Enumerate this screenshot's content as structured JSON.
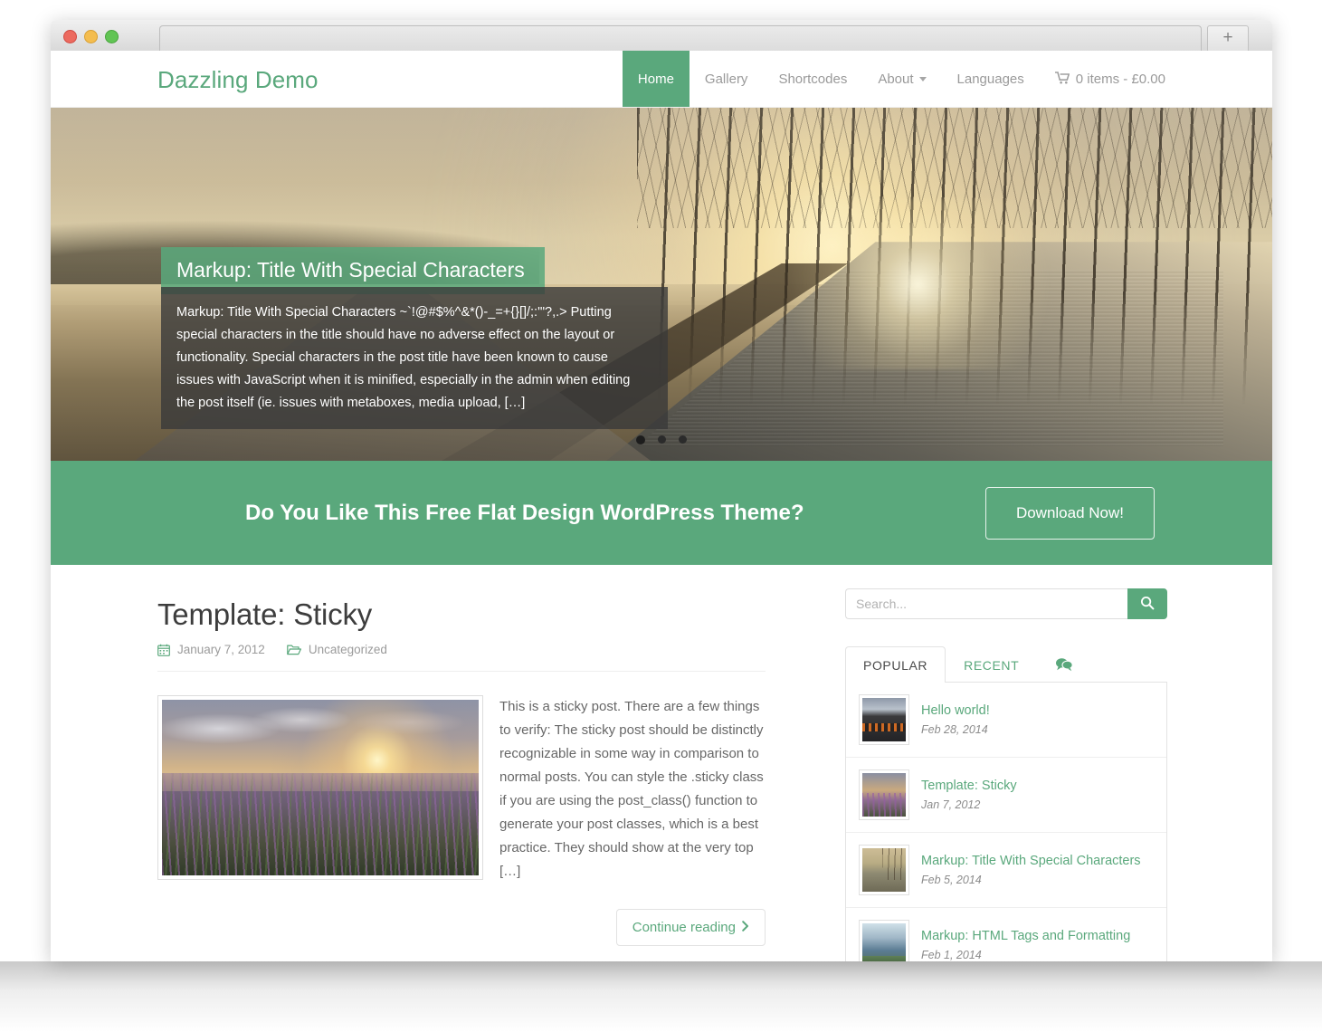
{
  "browser": {
    "traffic_lights": [
      "close",
      "minimize",
      "zoom"
    ],
    "new_tab_label": "+"
  },
  "header": {
    "brand": "Dazzling Demo",
    "nav": [
      {
        "label": "Home",
        "active": true,
        "caret": false
      },
      {
        "label": "Gallery",
        "active": false,
        "caret": false
      },
      {
        "label": "Shortcodes",
        "active": false,
        "caret": false
      },
      {
        "label": "About",
        "active": false,
        "caret": true
      },
      {
        "label": "Languages",
        "active": false,
        "caret": false
      }
    ],
    "cart_label": "0 items - £0.00"
  },
  "slider": {
    "title": "Markup: Title With Special Characters",
    "body": "Markup: Title With Special Characters ~`!@#$%^&*()-_=+{}[]/;:'\"?,.> Putting special characters in the title should have no adverse effect on the layout or functionality. Special characters in the post title have been known to cause issues with JavaScript when it is minified, especially in the admin when editing the post itself (ie. issues with metaboxes, media upload, […]",
    "dots": 3,
    "active_dot": 1
  },
  "cta": {
    "text": "Do You Like This Free Flat Design WordPress Theme?",
    "button": "Download Now!"
  },
  "post": {
    "title": "Template: Sticky",
    "date": "January 7, 2012",
    "category": "Uncategorized",
    "excerpt": "This is a sticky post. There are a few things to verify: The sticky post should be distinctly recognizable in some way in comparison to normal posts. You can style the .sticky class if you are using the post_class() function to generate your post classes, which is a best practice. They should show at the very top […]",
    "continue_label": "Continue reading"
  },
  "sidebar": {
    "search_placeholder": "Search...",
    "search_value": "",
    "tabs": [
      {
        "label": "POPULAR",
        "active": true
      },
      {
        "label": "RECENT",
        "active": false
      }
    ],
    "comments_tab": "comments-icon",
    "items": [
      {
        "title": "Hello world!",
        "date": "Feb 28, 2014"
      },
      {
        "title": "Template: Sticky",
        "date": "Jan 7, 2012"
      },
      {
        "title": "Markup: Title With Special Characters",
        "date": "Feb 5, 2014"
      },
      {
        "title": "Markup: HTML Tags and Formatting",
        "date": "Feb 1, 2014"
      }
    ]
  },
  "colors": {
    "accent_green": "#5aa87c",
    "text_dark": "#3d3d3d",
    "text_muted": "#9a9a9a"
  }
}
